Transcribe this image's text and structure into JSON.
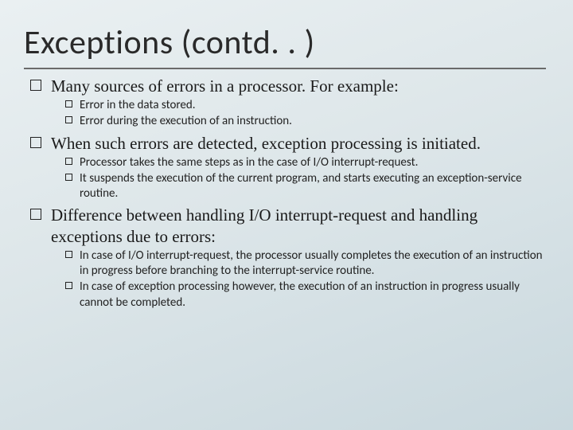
{
  "title": "Exceptions (contd. . )",
  "bullets": [
    {
      "text": "Many sources of errors in a processor. For example:",
      "sub": [
        "Error in the data stored.",
        "Error during the execution of an instruction."
      ]
    },
    {
      "text": "When such errors are detected, exception processing is initiated.",
      "sub": [
        "Processor takes the same steps as in the case of I/O interrupt-request.",
        "It suspends the execution of the current program, and starts executing an exception-service routine."
      ]
    },
    {
      "text": "Difference between handling I/O interrupt-request and handling exceptions due to errors:",
      "sub": [
        "In case of I/O interrupt-request, the processor usually completes the execution of an instruction in progress before branching to the interrupt-service routine.",
        "In case of exception processing however, the execution of an instruction in progress usually cannot be completed."
      ]
    }
  ]
}
